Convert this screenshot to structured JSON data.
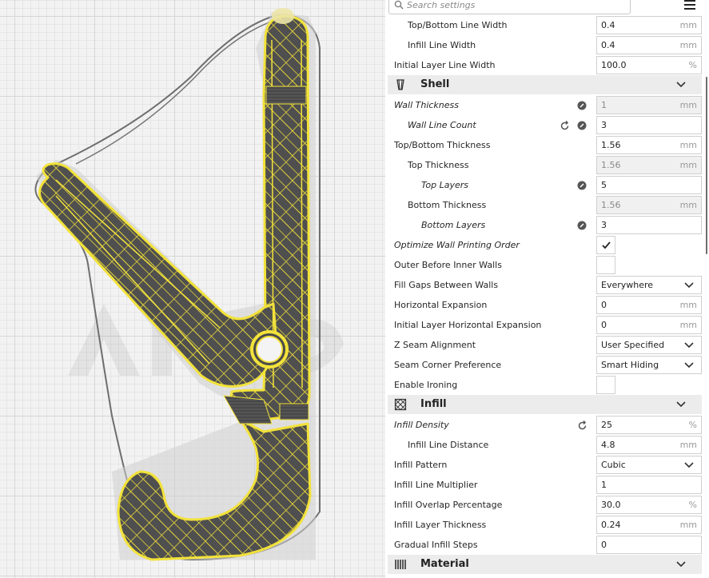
{
  "search": {
    "placeholder": "Search settings"
  },
  "rows_top": [
    {
      "label": "Top/Bottom Line Width",
      "value": "0.4",
      "unit": "mm",
      "indent": 1,
      "italic": false
    },
    {
      "label": "Infill Line Width",
      "value": "0.4",
      "unit": "mm",
      "indent": 1,
      "italic": false
    },
    {
      "label": "Initial Layer Line Width",
      "value": "100.0",
      "unit": "%",
      "indent": 0,
      "italic": false
    }
  ],
  "shell": {
    "title": "Shell",
    "icon": "shell-icon",
    "rows": [
      {
        "label": "Wall Thickness",
        "value": "1",
        "unit": "mm",
        "italic": true,
        "disabled": true,
        "link": true
      },
      {
        "label": "Wall Line Count",
        "value": "3",
        "unit": "",
        "italic": true,
        "link": true,
        "reset": true
      },
      {
        "label": "Top/Bottom Thickness",
        "value": "1.56",
        "unit": "mm"
      },
      {
        "label": "Top Thickness",
        "value": "1.56",
        "unit": "mm",
        "disabled": true
      },
      {
        "label": "Top Layers",
        "value": "5",
        "unit": "",
        "italic": true,
        "link": true
      },
      {
        "label": "Bottom Thickness",
        "value": "1.56",
        "unit": "mm",
        "disabled": true
      },
      {
        "label": "Bottom Layers",
        "value": "3",
        "unit": "",
        "italic": true,
        "link": true
      },
      {
        "label": "Optimize Wall Printing Order",
        "checked": true,
        "italic": true
      },
      {
        "label": "Outer Before Inner Walls",
        "checked": false
      },
      {
        "label": "Fill Gaps Between Walls",
        "value": "Everywhere",
        "dropdown": true
      },
      {
        "label": "Horizontal Expansion",
        "value": "0",
        "unit": "mm"
      },
      {
        "label": "Initial Layer Horizontal Expansion",
        "value": "0",
        "unit": "mm"
      },
      {
        "label": "Z Seam Alignment",
        "value": "User Specified",
        "dropdown": true
      },
      {
        "label": "Seam Corner Preference",
        "value": "Smart Hiding",
        "dropdown": true
      },
      {
        "label": "Enable Ironing",
        "checked": false
      }
    ]
  },
  "infill": {
    "title": "Infill",
    "icon": "infill-icon",
    "rows": [
      {
        "label": "Infill Density",
        "value": "25",
        "unit": "%",
        "italic": true,
        "reset": true
      },
      {
        "label": "Infill Line Distance",
        "value": "4.8",
        "unit": "mm"
      },
      {
        "label": "Infill Pattern",
        "value": "Cubic",
        "dropdown": true
      },
      {
        "label": "Infill Line Multiplier",
        "value": "1",
        "unit": ""
      },
      {
        "label": "Infill Overlap Percentage",
        "value": "30.0",
        "unit": "%"
      },
      {
        "label": "Infill Layer Thickness",
        "value": "0.24",
        "unit": "mm"
      },
      {
        "label": "Gradual Infill Steps",
        "value": "0",
        "unit": ""
      }
    ]
  },
  "material": {
    "title": "Material",
    "icon": "material-icon"
  },
  "colors": {
    "model_yellow": "#f2e23a",
    "model_gray": "#4a4a4a",
    "category_bg": "#ececec"
  }
}
